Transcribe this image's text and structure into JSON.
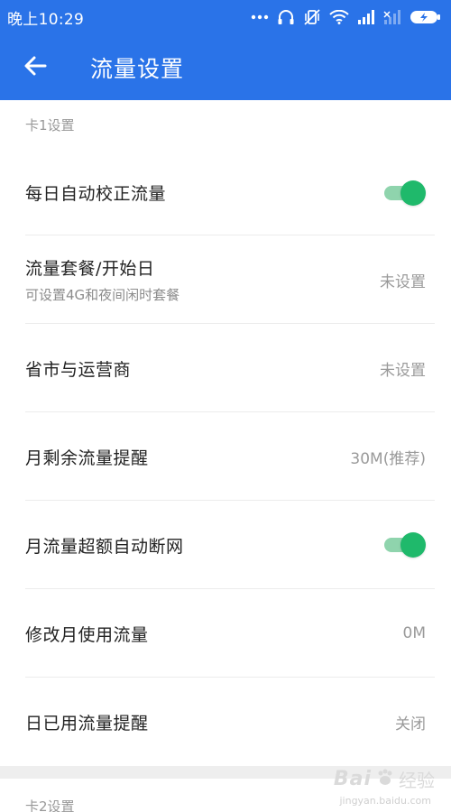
{
  "status_bar": {
    "time": "晚上10:29"
  },
  "app_bar": {
    "title": "流量设置",
    "back_icon": "arrow-left-icon"
  },
  "sections": [
    {
      "header": "卡1设置",
      "rows": [
        {
          "title": "每日自动校正流量",
          "type": "toggle",
          "on": true
        },
        {
          "title": "流量套餐/开始日",
          "subtitle": "可设置4G和夜间闲时套餐",
          "value": "未设置"
        },
        {
          "title": "省市与运营商",
          "value": "未设置"
        },
        {
          "title": "月剩余流量提醒",
          "value": "30M(推荐)"
        },
        {
          "title": "月流量超额自动断网",
          "type": "toggle",
          "on": true
        },
        {
          "title": "修改月使用流量",
          "value": "0M"
        },
        {
          "title": "日已用流量提醒",
          "value": "关闭"
        }
      ]
    },
    {
      "header": "卡2设置"
    }
  ],
  "colors": {
    "primary": "#2a73e8",
    "toggle_on": "#1fb96b",
    "toggle_track": "#8fd4ad"
  },
  "watermark": {
    "logo": "Bai",
    "text": "经验",
    "url": "jingyan.baidu.com"
  }
}
